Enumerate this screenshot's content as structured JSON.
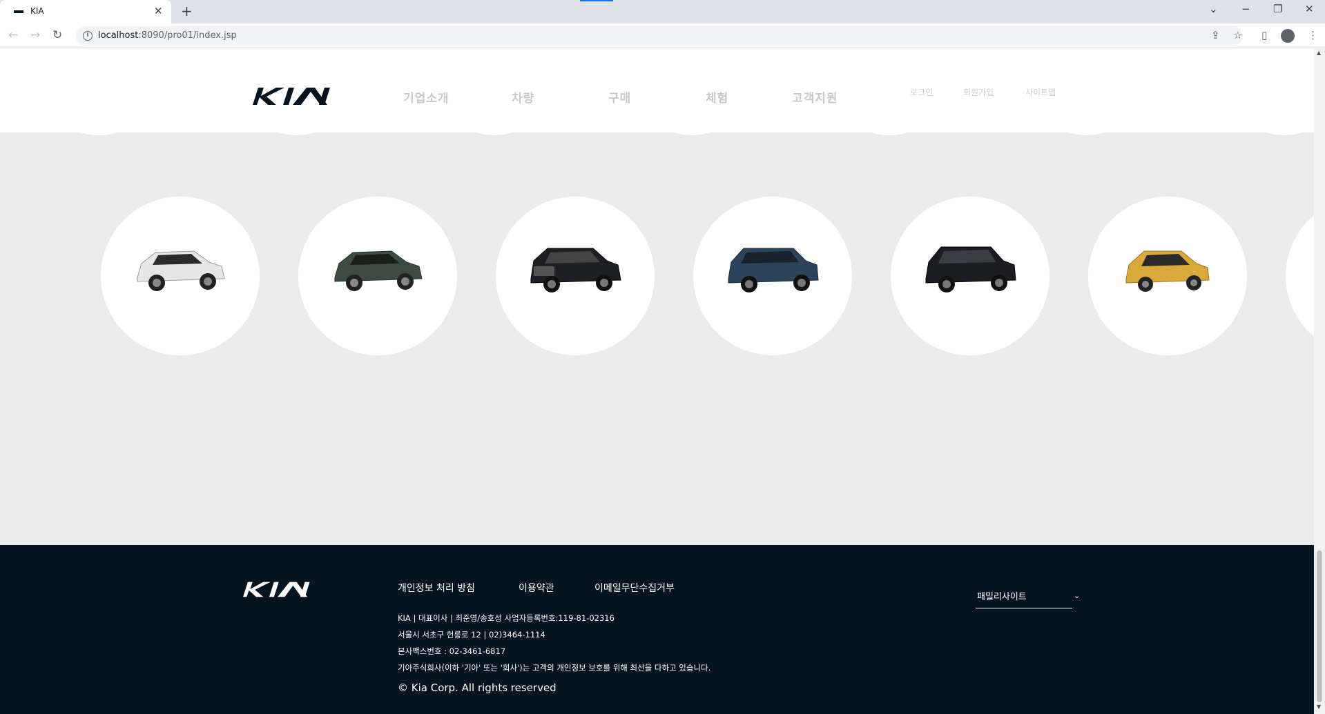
{
  "browser": {
    "tab_title": "KIA",
    "tab_close": "✕",
    "new_tab": "+",
    "back": "←",
    "forward": "→",
    "reload": "↻",
    "info": "i",
    "url_host": "localhost",
    "url_path": ":8090/pro01/index.jsp",
    "win_list": "⌄",
    "win_min": "−",
    "win_max": "❐",
    "win_close": "✕",
    "share": "⇪",
    "star": "☆",
    "sidepanel": "▯",
    "menu": "⋮"
  },
  "header": {
    "gnb": [
      "기업소개",
      "차량",
      "구매",
      "체험",
      "고객지원"
    ],
    "util": [
      "로그인",
      "회원가입",
      "사이트맵"
    ]
  },
  "cars": [
    {
      "name": "white-suv",
      "color": "#e6e6e6"
    },
    {
      "name": "green-suv",
      "color": "#3d4b43"
    },
    {
      "name": "black-large-suv",
      "color": "#1d1f22"
    },
    {
      "name": "blue-mpv",
      "color": "#2c445a"
    },
    {
      "name": "black-mpv",
      "color": "#1b1d20"
    },
    {
      "name": "yellow-hatchback",
      "color": "#d9a93a"
    }
  ],
  "footer": {
    "links": [
      "개인정보 처리 방침",
      "이용약관",
      "이메일무단수집거부"
    ],
    "info": [
      "KIA | 대표이사 | 최준영/송호성 사업자등록번호:119-81-02316",
      "서울시 서초구 헌릉로 12 | 02)3464-1114",
      "본사팩스번호 : 02-3461-6817",
      "기아주식회사(이하 '기아' 또는 '회사')는 고객의 개인정보 보호를 위해 최선을 다하고 있습니다."
    ],
    "copyright": "© Kia Corp. All rights reserved",
    "family_site": "패밀리사이트",
    "family_chevron": "⌄"
  },
  "scrollbar": {
    "up": "▲",
    "down": "▼"
  },
  "colors": {
    "footer_bg": "#05141f",
    "page_bg": "#ebebeb",
    "logo": "#05141f"
  }
}
